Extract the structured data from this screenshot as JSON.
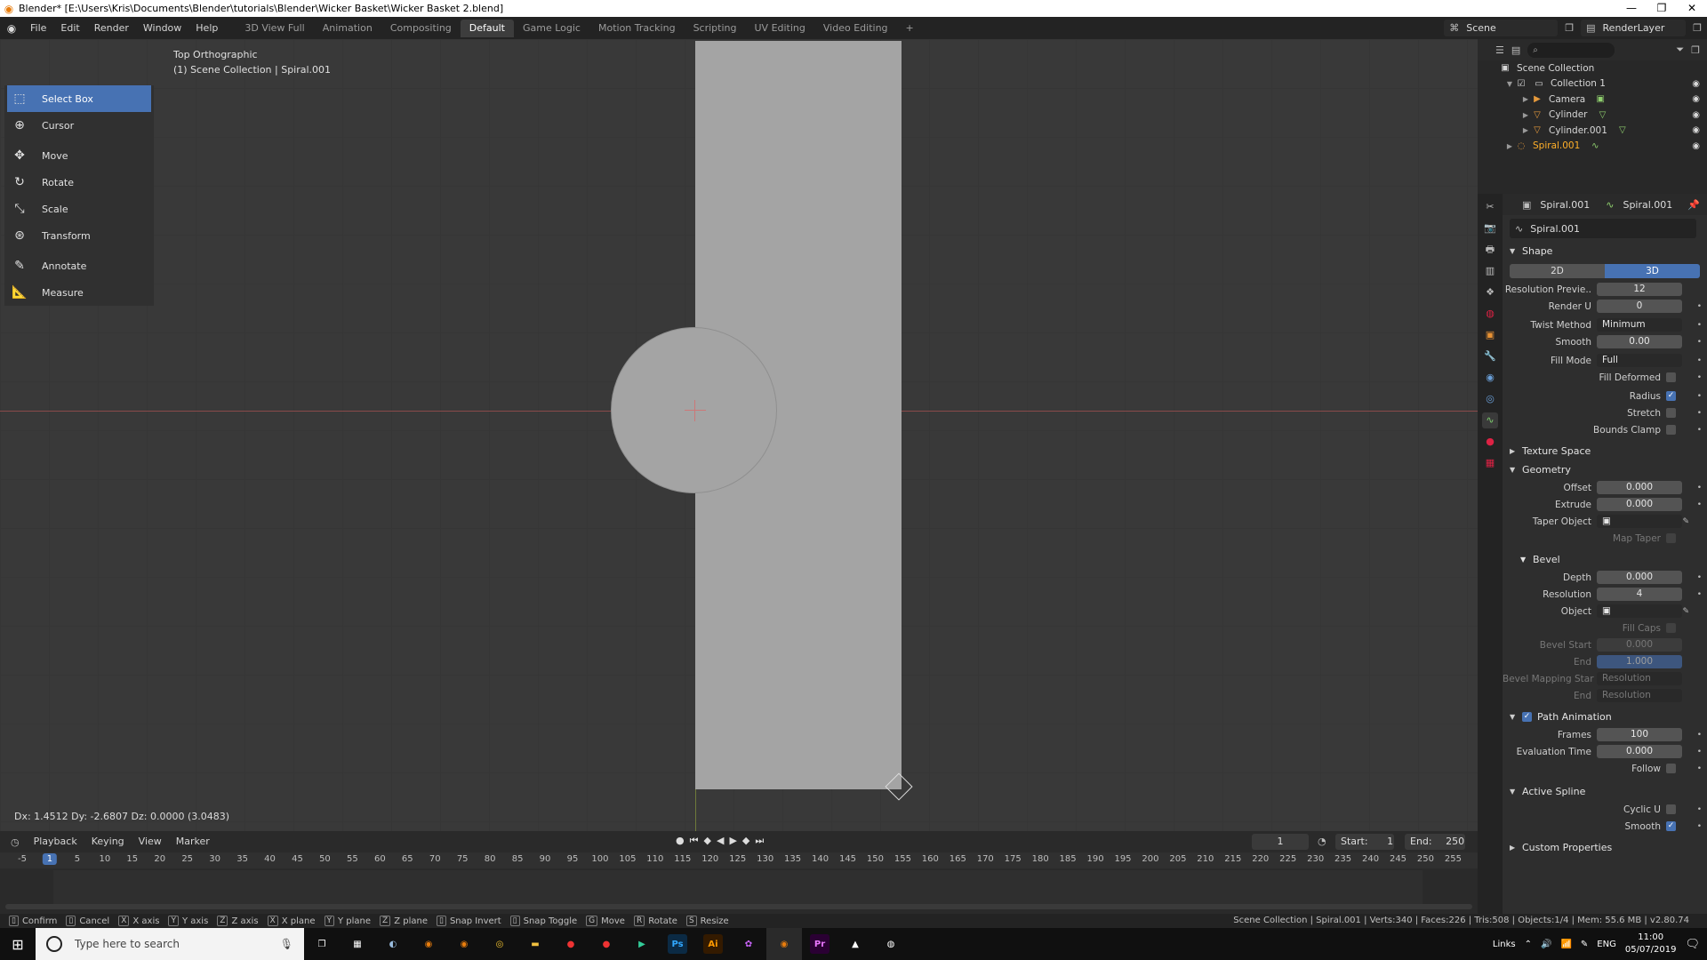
{
  "window": {
    "title": "Blender* [E:\\Users\\Kris\\Documents\\Blender\\tutorials\\Blender\\Wicker Basket\\Wicker Basket 2.blend]"
  },
  "menu": [
    "File",
    "Edit",
    "Render",
    "Window",
    "Help"
  ],
  "workspaces": [
    "3D View Full",
    "Animation",
    "Compositing",
    "Default",
    "Game Logic",
    "Motion Tracking",
    "Scripting",
    "UV Editing",
    "Video Editing"
  ],
  "workspace_add": "+",
  "scene_field": "Scene",
  "renderlayer_field": "RenderLayer",
  "viewport": {
    "view_name": "Top Orthographic",
    "collection_info": "(1) Scene Collection | Spiral.001",
    "transform_readout": "Dx: 1.4512   Dy: -2.6807   Dz: 0.0000 (3.0483)"
  },
  "tools": [
    {
      "label": "Select Box",
      "icon": "select-box-icon"
    },
    {
      "label": "Cursor",
      "icon": "cursor-icon"
    },
    {
      "label": "Move",
      "icon": "move-icon"
    },
    {
      "label": "Rotate",
      "icon": "rotate-icon"
    },
    {
      "label": "Scale",
      "icon": "scale-icon"
    },
    {
      "label": "Transform",
      "icon": "transform-icon"
    },
    {
      "label": "Annotate",
      "icon": "annotate-icon"
    },
    {
      "label": "Measure",
      "icon": "measure-icon"
    }
  ],
  "timeline": {
    "menus": [
      "Playback",
      "Keying",
      "View",
      "Marker"
    ],
    "current_frame": "1",
    "start_label": "Start:",
    "start": "1",
    "end_label": "End:",
    "end": "250",
    "ticks": [
      "-5",
      "1",
      "5",
      "10",
      "15",
      "20",
      "25",
      "30",
      "35",
      "40",
      "45",
      "50",
      "55",
      "60",
      "65",
      "70",
      "75",
      "80",
      "85",
      "90",
      "95",
      "100",
      "105",
      "110",
      "115",
      "120",
      "125",
      "130",
      "135",
      "140",
      "145",
      "150",
      "155",
      "160",
      "165",
      "170",
      "175",
      "180",
      "185",
      "190",
      "195",
      "200",
      "205",
      "210",
      "215",
      "220",
      "225",
      "230",
      "235",
      "240",
      "245",
      "250",
      "255"
    ]
  },
  "statusbar": {
    "keys": [
      {
        "key": "",
        "label": "Confirm"
      },
      {
        "key": "",
        "label": "Cancel"
      },
      {
        "key": "X",
        "label": "X axis"
      },
      {
        "key": "Y",
        "label": "Y axis"
      },
      {
        "key": "Z",
        "label": "Z axis"
      },
      {
        "key": "X",
        "label": "X plane"
      },
      {
        "key": "Y",
        "label": "Y plane"
      },
      {
        "key": "Z",
        "label": "Z plane"
      },
      {
        "key": "",
        "label": "Snap Invert"
      },
      {
        "key": "",
        "label": "Snap Toggle"
      },
      {
        "key": "G",
        "label": "Move"
      },
      {
        "key": "R",
        "label": "Rotate"
      },
      {
        "key": "S",
        "label": "Resize"
      }
    ],
    "stats": "Scene Collection | Spiral.001 | Verts:340 | Faces:226 | Tris:508 | Objects:1/4 | Mem: 55.6 MB | v2.80.74"
  },
  "outliner": {
    "search_placeholder": "",
    "rows": [
      {
        "label": "Scene Collection",
        "depth": 0
      },
      {
        "label": "Collection 1",
        "depth": 1
      },
      {
        "label": "Camera",
        "depth": 2
      },
      {
        "label": "Cylinder",
        "depth": 2
      },
      {
        "label": "Cylinder.001",
        "depth": 2
      },
      {
        "label": "Spiral.001",
        "depth": 1,
        "selected": true
      }
    ]
  },
  "properties": {
    "header_object": "Spiral.001",
    "header_data": "Spiral.001",
    "datablock": "Spiral.001",
    "shape_title": "Shape",
    "dim_2d": "2D",
    "dim_3d": "3D",
    "resolution_preview_label": "Resolution Previe..",
    "resolution_preview": "12",
    "render_u_label": "Render U",
    "render_u": "0",
    "twist_method_label": "Twist Method",
    "twist_method": "Minimum",
    "smooth_label": "Smooth",
    "smooth": "0.00",
    "fill_mode_label": "Fill Mode",
    "fill_mode": "Full",
    "fill_deformed_label": "Fill Deformed",
    "radius_label": "Radius",
    "stretch_label": "Stretch",
    "bounds_clamp_label": "Bounds Clamp",
    "texture_space_title": "Texture Space",
    "geometry_title": "Geometry",
    "offset_label": "Offset",
    "offset": "0.000",
    "extrude_label": "Extrude",
    "extrude": "0.000",
    "taper_object_label": "Taper Object",
    "map_taper_label": "Map Taper",
    "bevel_title": "Bevel",
    "depth_label": "Depth",
    "depth": "0.000",
    "resolution_label": "Resolution",
    "resolution": "4",
    "object_label": "Object",
    "fill_caps_label": "Fill Caps",
    "bevel_start_label": "Bevel Start",
    "bevel_start": "0.000",
    "end_label": "End",
    "end": "1.000",
    "bevel_mapping_start_label": "Bevel Mapping Star",
    "bevel_mapping_start": "Resolution",
    "mapping_end_label": "End",
    "mapping_end": "Resolution",
    "path_animation_title": "Path Animation",
    "frames_label": "Frames",
    "frames": "100",
    "evaluation_time_label": "Evaluation Time",
    "evaluation_time": "0.000",
    "follow_label": "Follow",
    "active_spline_title": "Active Spline",
    "cyclic_u_label": "Cyclic U",
    "active_smooth_label": "Smooth",
    "custom_properties_title": "Custom Properties"
  },
  "taskbar": {
    "search_placeholder": "Type here to search",
    "links_label": "Links",
    "lang": "ENG",
    "time": "11:00",
    "date": "05/07/2019"
  }
}
